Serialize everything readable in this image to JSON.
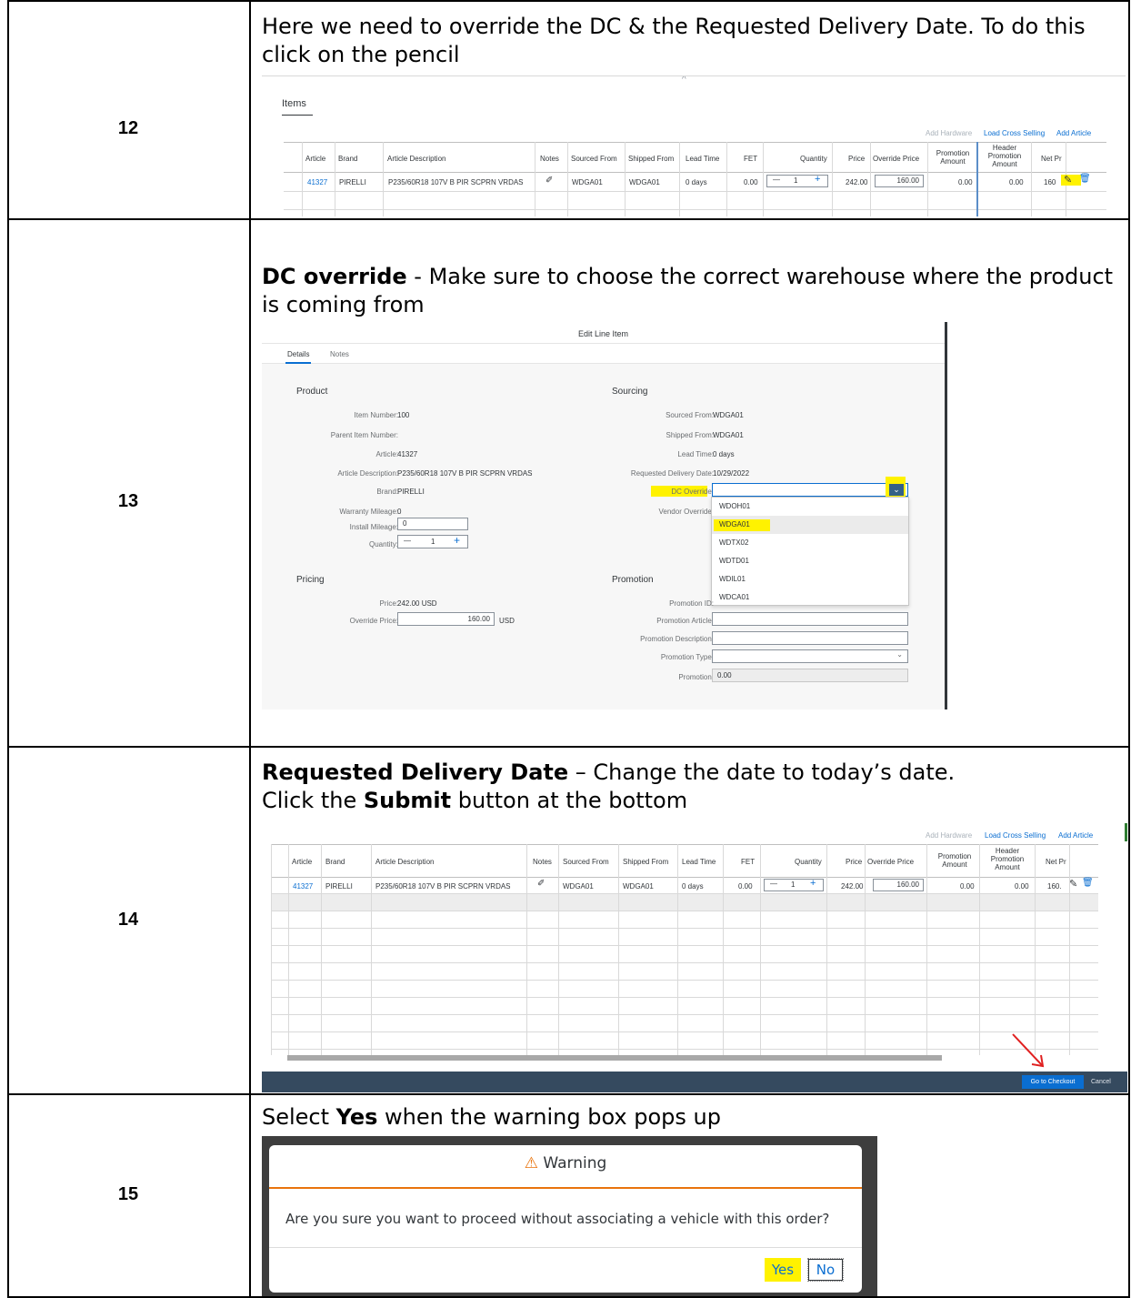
{
  "steps": [
    {
      "number": "12",
      "text": "Here we need to override the DC & the Requested Delivery Date. To do this click on the pencil"
    },
    {
      "number": "13",
      "bold": "DC override",
      "text": " - Make sure to choose the correct warehouse where the product is coming from"
    },
    {
      "number": "14",
      "bold": "Requested Delivery Date",
      "text_mid": " – Change the date to today’s date.",
      "line2_pre": "Click the ",
      "line2_bold": "Submit",
      "line2_post": " button at the bottom"
    },
    {
      "number": "15",
      "pre": "Select ",
      "bold": "Yes",
      "post": " when the warning box pops up"
    }
  ],
  "items_table": {
    "title": "Items",
    "actions": [
      "Add Hardware",
      "Load Cross Selling",
      "Add Article"
    ],
    "columns": [
      "Article",
      "Brand",
      "Article Description",
      "Notes",
      "Sourced From",
      "Shipped From",
      "Lead Time",
      "FET",
      "Quantity",
      "Price",
      "Override Price",
      "Promotion Amount",
      "Header Promotion Amount",
      "Net Pr"
    ],
    "row": {
      "article": "41327",
      "brand": "PIRELLI",
      "description": "P235/60R18 107V B PIR SCPRN VRDAS",
      "sourced_from": "WDGA01",
      "shipped_from": "WDGA01",
      "lead_time": "0 days",
      "fet": "0.00",
      "quantity": "1",
      "price": "242.00",
      "override_price": "160.00",
      "promotion_amount": "0.00",
      "header_promotion_amount": "0.00",
      "net_price": "160.",
      "net_price_12": "160"
    },
    "footer_buttons": [
      "Go to Checkout",
      "Cancel"
    ]
  },
  "edit_dialog": {
    "title": "Edit Line Item",
    "tabs": [
      "Details",
      "Notes"
    ],
    "product": {
      "heading": "Product",
      "fields": [
        {
          "label": "Item Number:",
          "value": "100"
        },
        {
          "label": "Parent Item Number:",
          "value": ""
        },
        {
          "label": "Article:",
          "value": "41327"
        },
        {
          "label": "Article Description:",
          "value": "P235/60R18 107V B PIR SCPRN VRDAS"
        },
        {
          "label": "Brand:",
          "value": "PIRELLI"
        },
        {
          "label": "Warranty Mileage:",
          "value": "0"
        },
        {
          "label": "Install Mileage:",
          "value": "0"
        },
        {
          "label": "Quantity:",
          "value": "1"
        }
      ]
    },
    "sourcing": {
      "heading": "Sourcing",
      "fields": [
        {
          "label": "Sourced From:",
          "value": "WDGA01"
        },
        {
          "label": "Shipped From:",
          "value": "WDGA01"
        },
        {
          "label": "Lead Time:",
          "value": "0 days"
        },
        {
          "label": "Requested Delivery Date:",
          "value": "10/29/2022"
        },
        {
          "label": "DC Override:",
          "value": ""
        },
        {
          "label": "Vendor Override:",
          "value": ""
        }
      ],
      "dc_options": [
        "WDOH01",
        "WDGA01",
        "WDTX02",
        "WDTD01",
        "WDIL01",
        "WDCA01"
      ]
    },
    "pricing": {
      "heading": "Pricing",
      "price_label": "Price:",
      "price_value": "242.00 USD",
      "override_label": "Override Price:",
      "override_value": "160.00",
      "override_unit": "USD"
    },
    "promotion": {
      "heading": "Promotion",
      "fields": [
        "Promotion ID:",
        "Promotion Article:",
        "Promotion Description:",
        "Promotion Type:",
        "Promotion:"
      ],
      "promotion_value": "0.00"
    }
  },
  "warning": {
    "title": "Warning",
    "message": "Are you sure you want to proceed without associating a vehicle with this order?",
    "yes": "Yes",
    "no": "No"
  },
  "colors": {
    "highlight": "#fff200",
    "link": "#0a6ed1",
    "warning_orange": "#e9730c",
    "footer_bar": "#354a5f",
    "checkout_blue": "#0a6ed1"
  }
}
